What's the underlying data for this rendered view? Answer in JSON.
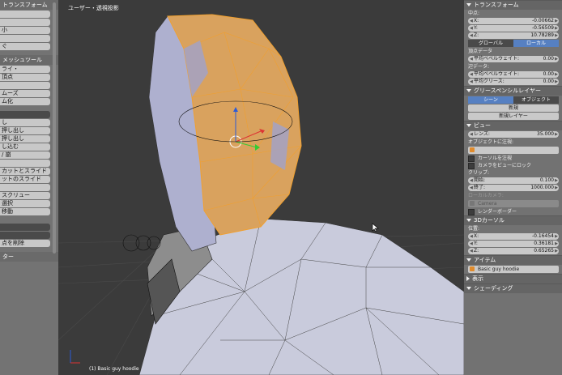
{
  "left_panel": {
    "header1": "トランスフォーム",
    "items1": [
      "",
      "",
      "小",
      "",
      "ぐ"
    ],
    "header2": "メッシュツール",
    "items2": [
      "ライ・",
      "頂点",
      "",
      "ムーズ",
      "ム化"
    ],
    "items3": [
      "し",
      "押し出し",
      "押し出し",
      "し込む",
      "/ 崩",
      "",
      "カットとスライド",
      "ットのスライド",
      "",
      "スクリュー",
      "選択",
      "移動"
    ],
    "item_last": "点を削除",
    "header3": "ター"
  },
  "viewport": {
    "title": "ユーザー・透視投影",
    "status": "(1) Basic guy hoodie"
  },
  "right_panel": {
    "transform_header": "トランスフォーム",
    "median_label": "中点:",
    "x": {
      "key": "X:",
      "value": "-0.00662"
    },
    "y": {
      "key": "Y:",
      "value": "-0.56509"
    },
    "z": {
      "key": "Z:",
      "value": "10.78289"
    },
    "global_label": "グローバル",
    "local_label": "ローカル",
    "vertex_data_label": "頂点データ",
    "vertex_bevel": {
      "key": "平均ベベルウェイト:",
      "value": "0.00"
    },
    "edge_data_label": "辺データ:",
    "edge_bevel": {
      "key": "平均ベベルウェイト:",
      "value": "0.00"
    },
    "edge_crease": {
      "key": "平均クリース:",
      "value": "0.00"
    },
    "grease_header": "グリースペンシルレイヤー",
    "scene_label": "シーン",
    "object_label": "オブジェクト",
    "new_label": "新規",
    "new_layer_label": "新規レイヤー",
    "view_header": "ビュー",
    "lens": {
      "key": "レンズ:",
      "value": "35.000"
    },
    "lock_object_label": "オブジェクトに注視:",
    "lock_cursor_label": "カーソルを注視",
    "lock_camera_label": "カメラをビューにロック",
    "clip_label": "クリップ:",
    "clip_start": {
      "key": "開始:",
      "value": "0.100"
    },
    "clip_end": {
      "key": "終了:",
      "value": "1000.000"
    },
    "local_camera_label": "ローカルカメラ:",
    "camera_field": "Camera",
    "render_border_label": "レンダーボーダー",
    "cursor_header": "3Dカーソル",
    "location_label": "位置:",
    "cx": {
      "key": "X:",
      "value": "-0.16454"
    },
    "cy": {
      "key": "Y:",
      "value": "0.36181"
    },
    "cz": {
      "key": "Z:",
      "value": "0.65265"
    },
    "item_header": "アイテム",
    "item_name": "Basic guy hoodie",
    "display_header": "表示",
    "shading_header": "シェーディング"
  }
}
